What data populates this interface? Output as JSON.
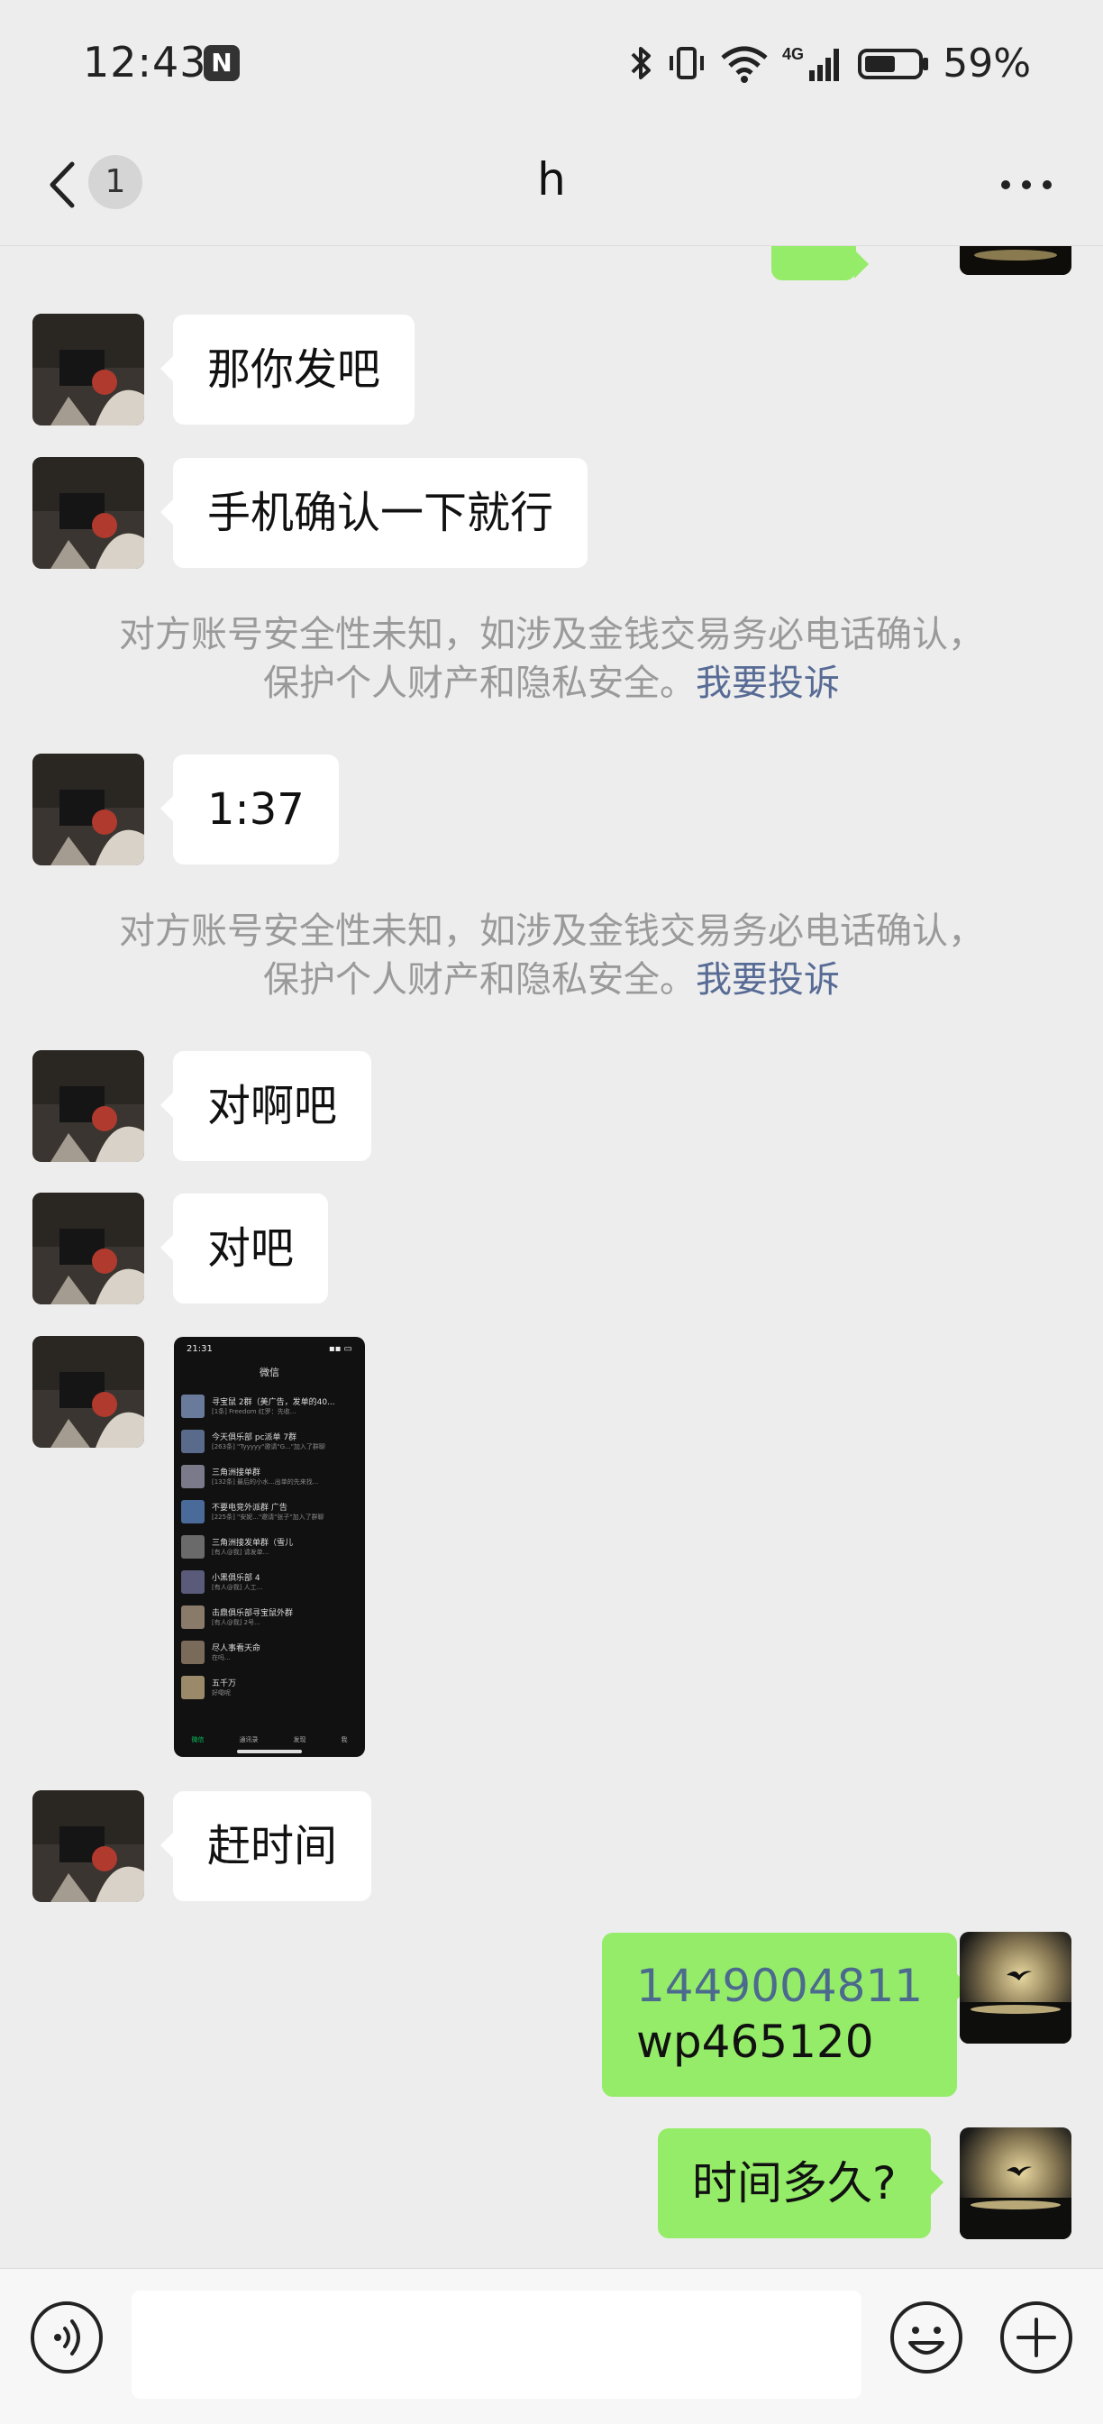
{
  "status_bar": {
    "time": "12:43",
    "network": "4G",
    "battery": "59%",
    "battery_level": 0.59
  },
  "nav": {
    "unread_count": "1",
    "title": "h",
    "icons": [
      "chevron-left-icon",
      "more-icon"
    ]
  },
  "messages": [
    {
      "from": "other",
      "type": "text",
      "text": "那你发吧"
    },
    {
      "from": "other",
      "type": "text",
      "text": "手机确认一下就行"
    },
    {
      "type": "system",
      "line1": "对方账号安全性未知，如涉及金钱交易务必电话确认，",
      "line2": "保护个人财产和隐私安全。",
      "link": "我要投诉"
    },
    {
      "from": "other",
      "type": "text",
      "text": "1:37"
    },
    {
      "type": "system",
      "line1": "对方账号安全性未知，如涉及金钱交易务必电话确认，",
      "line2": "保护个人财产和隐私安全。",
      "link": "我要投诉"
    },
    {
      "from": "other",
      "type": "text",
      "text": "对啊吧"
    },
    {
      "from": "other",
      "type": "text",
      "text": "对吧"
    },
    {
      "from": "other",
      "type": "image",
      "screenshot": {
        "time": "21:31",
        "title": "微信",
        "rows": [
          {
            "name": "寻宝鼠 2群（美广告，发单的40...",
            "preview": "[1条] Freedom 红罗：先收...",
            "color": "#6a7a9a"
          },
          {
            "name": "今天俱乐部 pc派单 7群",
            "preview": "[263条] \"Tyyyyy\"邀请\"G...\"加入了群聊",
            "color": "#5a6a8a"
          },
          {
            "name": "三角洲接单群",
            "preview": "[132条] 最后的小水...出单的先来找...",
            "color": "#7a7a8a"
          },
          {
            "name": "不要电竞外派群 广告",
            "preview": "[225条] \"安妮...\"邀请\"张子\"加入了群聊",
            "color": "#4a6a9a"
          },
          {
            "name": "三角洲接发单群（雪儿",
            "preview": "[有人@我] 请发单...",
            "color": "#6a6a6a"
          },
          {
            "name": "小黑俱乐部 4",
            "preview": "[有人@我] 人工...",
            "color": "#5a5a7a"
          },
          {
            "name": "击鼎俱乐部寻宝鼠外群",
            "preview": "[有人@我] 2号...",
            "color": "#8a7a6a"
          },
          {
            "name": "尽人事看天命",
            "preview": "在吗...",
            "color": "#7a6a5a"
          },
          {
            "name": "五千万",
            "preview": "好嘞呢",
            "color": "#9a8a6a"
          }
        ],
        "tabs": [
          "微信",
          "通讯录",
          "发现",
          "我"
        ]
      }
    },
    {
      "from": "other",
      "type": "text",
      "text": "赶时间"
    },
    {
      "from": "me",
      "type": "text",
      "line1": "1449004811",
      "line2": "wp465120"
    },
    {
      "from": "me",
      "type": "text",
      "text": "时间多久?"
    }
  ],
  "input_bar": {
    "placeholder": "",
    "icons": [
      "voice-icon",
      "emoji-icon",
      "plus-icon"
    ]
  },
  "colors": {
    "background": "#ededed",
    "incoming_bubble": "#ffffff",
    "outgoing_bubble": "#95ec69",
    "system_text": "#9a9a9a",
    "link": "#576b95"
  }
}
